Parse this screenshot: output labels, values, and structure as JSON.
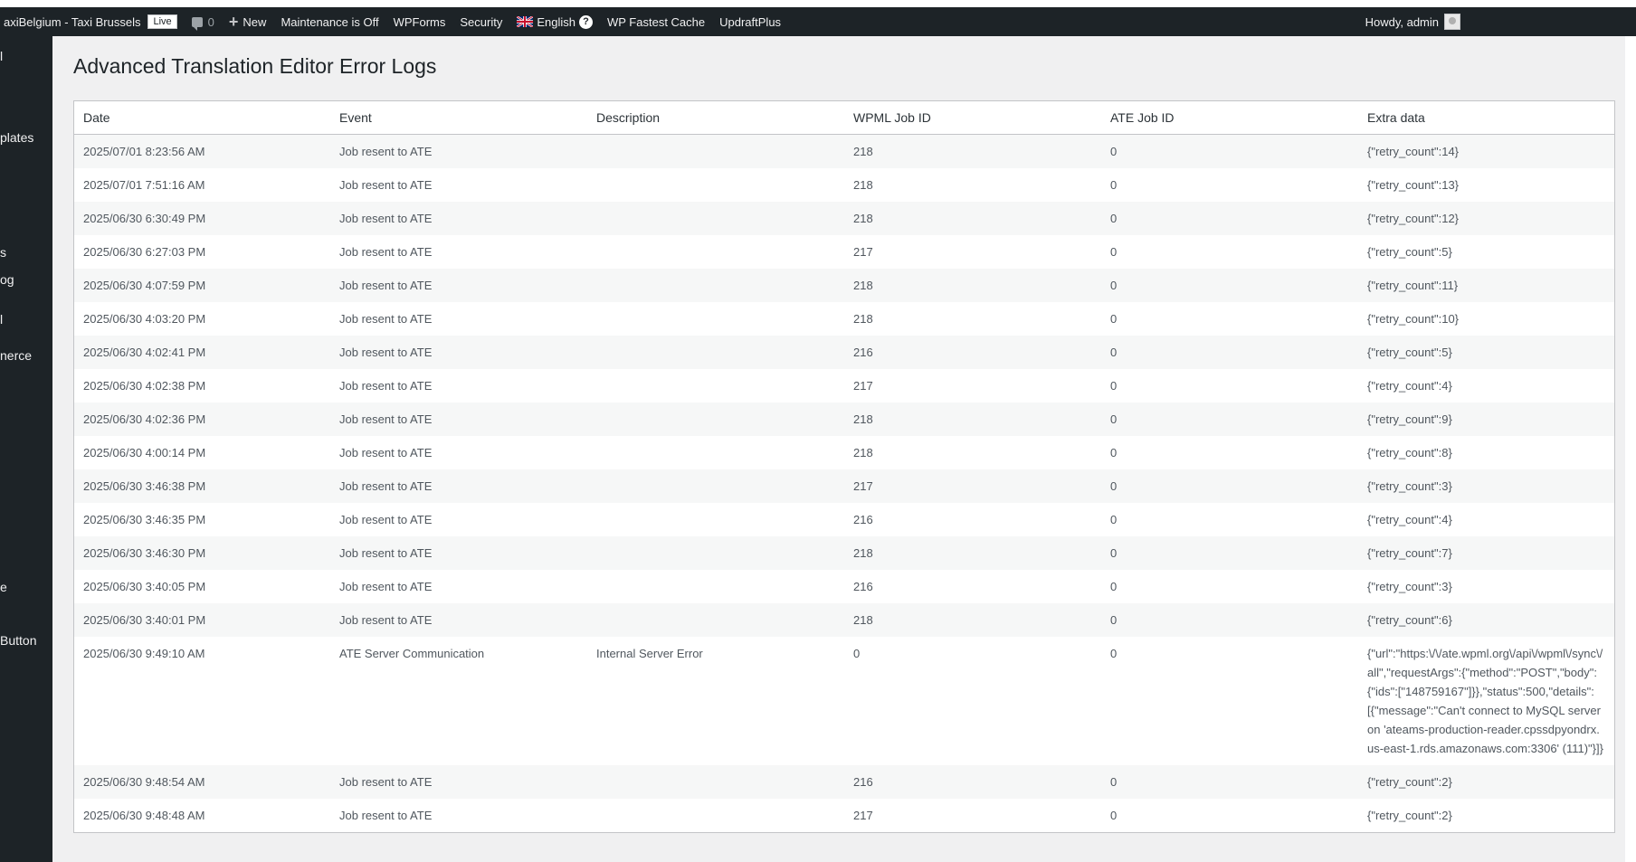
{
  "admin_bar": {
    "site_name": "axiBelgium - Taxi Brussels",
    "live_badge": "Live",
    "comments_count": "0",
    "new_label": "New",
    "maintenance": "Maintenance is Off",
    "wpforms": "WPForms",
    "security": "Security",
    "language": "English",
    "help": "?",
    "fastest_cache": "WP Fastest Cache",
    "updraft": "UpdraftPlus",
    "howdy": "Howdy, admin"
  },
  "sidebar": {
    "items": [
      {
        "label": "l"
      },
      {
        "label": "plates"
      },
      {
        "label": "s"
      },
      {
        "label": "og"
      },
      {
        "label": "l"
      },
      {
        "label": "nerce"
      },
      {
        "label": "e"
      },
      {
        "label": "Button"
      }
    ]
  },
  "page": {
    "title": "Advanced Translation Editor Error Logs"
  },
  "table": {
    "headers": [
      "Date",
      "Event",
      "Description",
      "WPML Job ID",
      "ATE Job ID",
      "Extra data"
    ],
    "rows": [
      {
        "date": "2025/07/01 8:23:56 AM",
        "event": "Job resent to ATE",
        "description": "",
        "wpml_job_id": "218",
        "ate_job_id": "0",
        "extra": "{\"retry_count\":14}"
      },
      {
        "date": "2025/07/01 7:51:16 AM",
        "event": "Job resent to ATE",
        "description": "",
        "wpml_job_id": "218",
        "ate_job_id": "0",
        "extra": "{\"retry_count\":13}"
      },
      {
        "date": "2025/06/30 6:30:49 PM",
        "event": "Job resent to ATE",
        "description": "",
        "wpml_job_id": "218",
        "ate_job_id": "0",
        "extra": "{\"retry_count\":12}"
      },
      {
        "date": "2025/06/30 6:27:03 PM",
        "event": "Job resent to ATE",
        "description": "",
        "wpml_job_id": "217",
        "ate_job_id": "0",
        "extra": "{\"retry_count\":5}"
      },
      {
        "date": "2025/06/30 4:07:59 PM",
        "event": "Job resent to ATE",
        "description": "",
        "wpml_job_id": "218",
        "ate_job_id": "0",
        "extra": "{\"retry_count\":11}"
      },
      {
        "date": "2025/06/30 4:03:20 PM",
        "event": "Job resent to ATE",
        "description": "",
        "wpml_job_id": "218",
        "ate_job_id": "0",
        "extra": "{\"retry_count\":10}"
      },
      {
        "date": "2025/06/30 4:02:41 PM",
        "event": "Job resent to ATE",
        "description": "",
        "wpml_job_id": "216",
        "ate_job_id": "0",
        "extra": "{\"retry_count\":5}"
      },
      {
        "date": "2025/06/30 4:02:38 PM",
        "event": "Job resent to ATE",
        "description": "",
        "wpml_job_id": "217",
        "ate_job_id": "0",
        "extra": "{\"retry_count\":4}"
      },
      {
        "date": "2025/06/30 4:02:36 PM",
        "event": "Job resent to ATE",
        "description": "",
        "wpml_job_id": "218",
        "ate_job_id": "0",
        "extra": "{\"retry_count\":9}"
      },
      {
        "date": "2025/06/30 4:00:14 PM",
        "event": "Job resent to ATE",
        "description": "",
        "wpml_job_id": "218",
        "ate_job_id": "0",
        "extra": "{\"retry_count\":8}"
      },
      {
        "date": "2025/06/30 3:46:38 PM",
        "event": "Job resent to ATE",
        "description": "",
        "wpml_job_id": "217",
        "ate_job_id": "0",
        "extra": "{\"retry_count\":3}"
      },
      {
        "date": "2025/06/30 3:46:35 PM",
        "event": "Job resent to ATE",
        "description": "",
        "wpml_job_id": "216",
        "ate_job_id": "0",
        "extra": "{\"retry_count\":4}"
      },
      {
        "date": "2025/06/30 3:46:30 PM",
        "event": "Job resent to ATE",
        "description": "",
        "wpml_job_id": "218",
        "ate_job_id": "0",
        "extra": "{\"retry_count\":7}"
      },
      {
        "date": "2025/06/30 3:40:05 PM",
        "event": "Job resent to ATE",
        "description": "",
        "wpml_job_id": "216",
        "ate_job_id": "0",
        "extra": "{\"retry_count\":3}"
      },
      {
        "date": "2025/06/30 3:40:01 PM",
        "event": "Job resent to ATE",
        "description": "",
        "wpml_job_id": "218",
        "ate_job_id": "0",
        "extra": "{\"retry_count\":6}"
      },
      {
        "date": "2025/06/30 9:49:10 AM",
        "event": "ATE Server Communication",
        "description": "Internal Server Error",
        "wpml_job_id": "0",
        "ate_job_id": "0",
        "extra": "{\"url\":\"https:\\/\\/ate.wpml.org\\/api\\/wpml\\/sync\\/all\",\"requestArgs\":{\"method\":\"POST\",\"body\":{\"ids\":[\"148759167\"]}},\"status\":500,\"details\":[{\"message\":\"Can't connect to MySQL server on 'ateams-production-reader.cpssdpyondrx.us-east-1.rds.amazonaws.com:3306' (111)\"}]}"
      },
      {
        "date": "2025/06/30 9:48:54 AM",
        "event": "Job resent to ATE",
        "description": "",
        "wpml_job_id": "216",
        "ate_job_id": "0",
        "extra": "{\"retry_count\":2}"
      },
      {
        "date": "2025/06/30 9:48:48 AM",
        "event": "Job resent to ATE",
        "description": "",
        "wpml_job_id": "217",
        "ate_job_id": "0",
        "extra": "{\"retry_count\":2}"
      }
    ]
  }
}
